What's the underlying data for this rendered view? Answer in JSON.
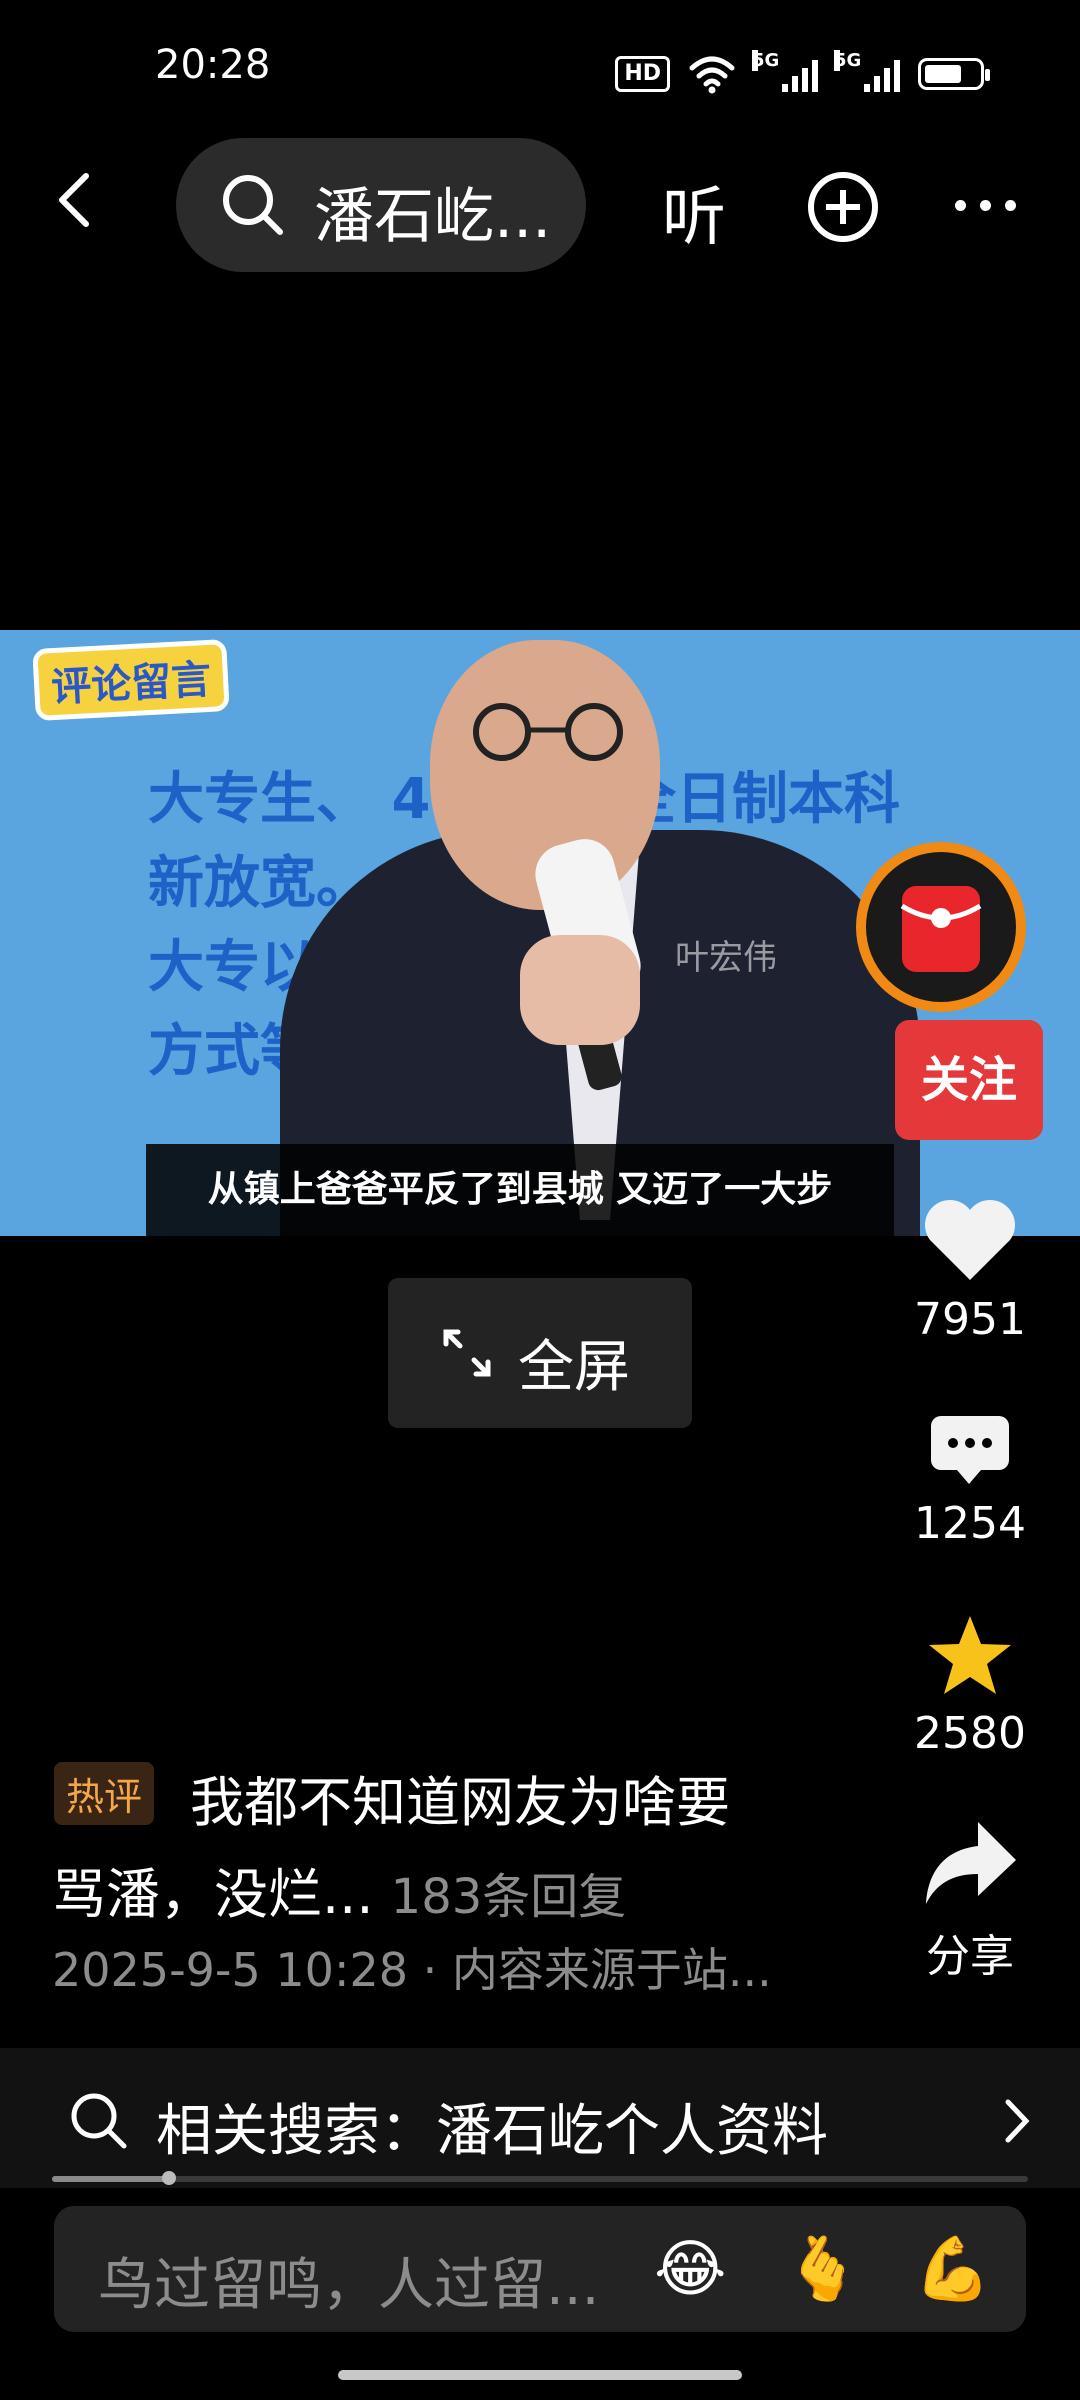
{
  "status_bar": {
    "time": "20:28",
    "hd": "HD",
    "net1": "5G",
    "net2": "5G"
  },
  "nav": {
    "search_text": "潘石屹...",
    "listen": "听"
  },
  "video": {
    "badge": "评论留言",
    "subtitle": "从镇上爸爸平反了到县城 又迈了一大步",
    "watermark": "叶宏伟"
  },
  "fullscreen_label": "全屏",
  "rail": {
    "follow": "关注",
    "likes": "7951",
    "comments": "1254",
    "favorites": "2580",
    "share": "分享"
  },
  "hot_comment": {
    "tag": "热评",
    "line1": "我都不知道网友为啥要",
    "line2": "骂潘，没烂...",
    "replies": "183条回复",
    "meta": "2025-9-5 10:28 · 内容来源于站..."
  },
  "related_search": "相关搜索：潘石屹个人资料",
  "progress": 0.12,
  "comment_input": {
    "placeholder": "鸟过留鸣，人过留..."
  },
  "emojis": [
    "😂",
    "🫰",
    "💪"
  ],
  "colors": {
    "follow_red": "#e5383b",
    "star": "#f7c21a",
    "hot_tag": "#f3a64a"
  }
}
